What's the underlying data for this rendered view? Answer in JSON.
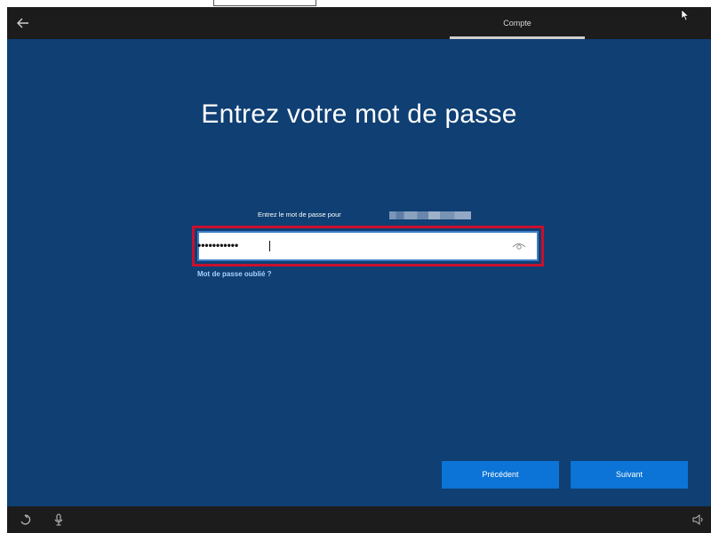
{
  "header": {
    "step_label": "Compte"
  },
  "main": {
    "title": "Entrez votre mot de passe",
    "prompt": "Entrez le mot de passe pour",
    "password_masked": "•••••••••••",
    "forgot_link": "Mot de passe oublié ?"
  },
  "buttons": {
    "previous": "Précédent",
    "next": "Suivant"
  },
  "colors": {
    "background": "#0f3f73",
    "bars": "#1c1c1c",
    "accent": "#0b74d6",
    "highlight": "#c8102e",
    "link": "#a8d2ff"
  },
  "icons": {
    "back": "arrow-left-icon",
    "reveal": "eye-icon",
    "ease_of_access": "ease-of-access-icon",
    "microphone": "microphone-icon",
    "volume": "speaker-icon",
    "cursor": "mouse-pointer-icon"
  }
}
